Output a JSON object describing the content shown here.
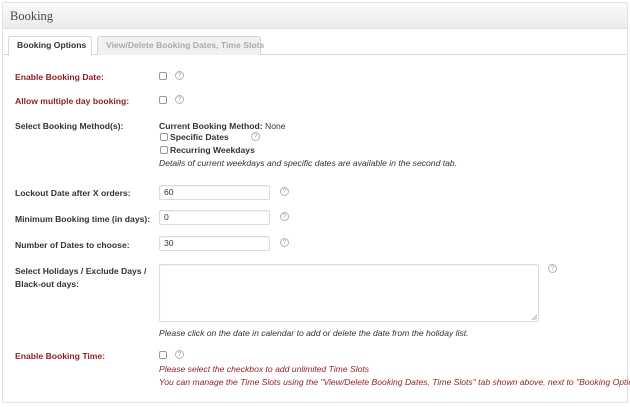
{
  "panel": {
    "title": "Booking"
  },
  "tabs": [
    {
      "label": "Booking Options"
    },
    {
      "label": "View/Delete Booking Dates, Time Slots"
    }
  ],
  "icons": {
    "help": "help-circle-icon",
    "checkbox": "checkbox-icon"
  },
  "help_glyph": "?",
  "colors": {
    "required_label": "#8e1f1f",
    "note_red": "#8e1f1f",
    "tab_inactive_text": "#aaaaaa"
  },
  "fields": {
    "enable_booking_date": {
      "label": "Enable Booking Date:"
    },
    "allow_multiple_day": {
      "label": "Allow multiple day booking:"
    },
    "booking_method": {
      "label": "Select Booking Method(s):",
      "current_prefix": "Current Booking Method:",
      "current_value": " None",
      "option_specific": "Specific Dates",
      "option_recurring": "Recurring Weekdays",
      "note": "Details of current weekdays and specific dates are available in the second tab."
    },
    "lockout": {
      "label": "Lockout Date after X orders:",
      "value": "60"
    },
    "min_booking": {
      "label": "Minimum Booking time (in days):",
      "value": "0"
    },
    "num_dates": {
      "label": "Number of Dates to choose:",
      "value": "30"
    },
    "holidays": {
      "label_line1": "Select Holidays / Exclude Days /",
      "label_line2": "Black-out days:",
      "value": "",
      "note": "Please click on the date in calendar to add or delete the date from the holiday list."
    },
    "enable_booking_time": {
      "label": "Enable Booking Time:",
      "note1": "Please select the checkbox to add unlimited Time Slots",
      "note2": "You can manage the Time Slots using the \"View/Delete Booking Dates, Time Slots\" tab shown above, next to \"Booking Options\"."
    }
  }
}
